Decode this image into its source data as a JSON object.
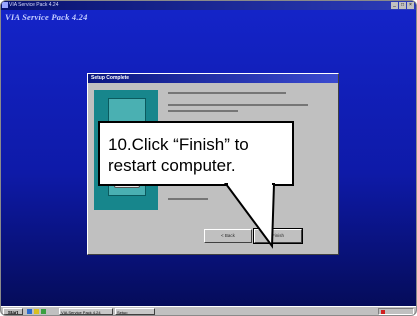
{
  "window": {
    "title": "VIA Service Pack 4.24",
    "controls": [
      "_",
      "□",
      "×"
    ]
  },
  "banner": {
    "title": "VIA Service Pack 4.24"
  },
  "dialog": {
    "title": "Setup Complete",
    "back_label": "< Back",
    "finish_label": "Finish"
  },
  "callout": {
    "text": "10.Click “Finish” to restart computer."
  },
  "taskbar": {
    "start_label": "Start",
    "tasks": [
      "VIA Service Pack 4.24",
      "Setup"
    ],
    "clock": ""
  },
  "colors": {
    "desktop": "#1424c8",
    "titlebar": "#08126e",
    "dialog_face": "#c0c0c0",
    "graphic_teal": "#17868c"
  },
  "icons": [
    "app-icon",
    "setup-graphic",
    "start-icon",
    "systray-icon"
  ]
}
